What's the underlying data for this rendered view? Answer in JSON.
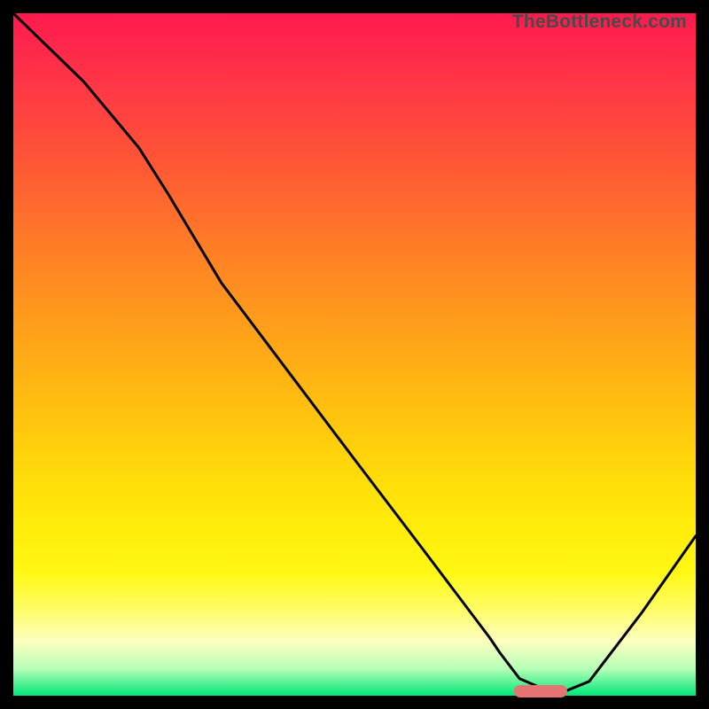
{
  "watermark": "TheBottleneck.com",
  "colors": {
    "page_bg": "#000000",
    "curve_stroke": "#000000",
    "sweet_spot_fill": "#e57373",
    "gradient_top": "#ff1a4d",
    "gradient_bottom": "#00e676"
  },
  "chart_data": {
    "type": "line",
    "title": "",
    "xlabel": "",
    "ylabel": "",
    "x_range": [
      0,
      100
    ],
    "y_range": [
      0,
      100
    ],
    "description": "Bottleneck percentage curve descending from top-left, flattening at the sweet-spot, then rising at right.",
    "series": [
      {
        "name": "bottleneck-curve",
        "x": [
          0.0,
          10.3,
          18.4,
          22.7,
          30.5,
          40.3,
          50.1,
          60.0,
          69.8,
          71.3,
          74.2,
          78.1,
          80.5,
          84.4,
          92.2,
          100.0
        ],
        "y": [
          100.0,
          90.0,
          80.3,
          73.5,
          60.5,
          47.5,
          34.5,
          21.5,
          8.5,
          6.3,
          2.5,
          0.8,
          0.5,
          2.1,
          12.3,
          23.4
        ]
      }
    ],
    "sweet_spot": {
      "x_start": 73.4,
      "x_end": 81.2,
      "y": 0.6
    },
    "background_gradient_values": [
      100,
      0
    ]
  }
}
